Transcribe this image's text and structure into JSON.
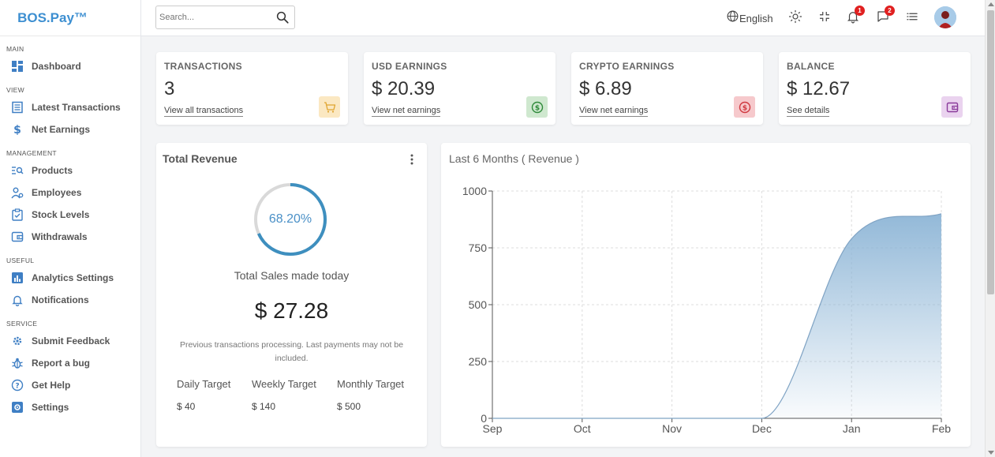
{
  "brand": {
    "name": "BOS.Pay™"
  },
  "search": {
    "placeholder": "Search..."
  },
  "topbar": {
    "language": "English",
    "notifications_count": "1",
    "messages_count": "2"
  },
  "sidebar": {
    "sections": [
      {
        "title": "MAIN",
        "items": [
          {
            "label": "Dashboard",
            "icon": "dashboard-icon"
          }
        ]
      },
      {
        "title": "VIEW",
        "items": [
          {
            "label": "Latest Transactions",
            "icon": "list-icon"
          },
          {
            "label": "Net Earnings",
            "icon": "dollar-icon"
          }
        ]
      },
      {
        "title": "MANAGEMENT",
        "items": [
          {
            "label": "Products",
            "icon": "products-search-icon"
          },
          {
            "label": "Employees",
            "icon": "employees-icon"
          },
          {
            "label": "Stock Levels",
            "icon": "clipboard-icon"
          },
          {
            "label": "Withdrawals",
            "icon": "wallet-icon"
          }
        ]
      },
      {
        "title": "USEFUL",
        "items": [
          {
            "label": "Analytics Settings",
            "icon": "analytics-icon"
          },
          {
            "label": "Notifications",
            "icon": "bell-icon"
          }
        ]
      },
      {
        "title": "SERVICE",
        "items": [
          {
            "label": "Submit Feedback",
            "icon": "feedback-icon"
          },
          {
            "label": "Report a bug",
            "icon": "bug-icon"
          },
          {
            "label": "Get Help",
            "icon": "help-icon"
          },
          {
            "label": "Settings",
            "icon": "settings-icon"
          }
        ]
      }
    ]
  },
  "stats": [
    {
      "title": "TRANSACTIONS",
      "value": "3",
      "link": "View all transactions",
      "icon": "cart-icon",
      "icon_bg": "#fbe8c2",
      "icon_color": "#e0a530"
    },
    {
      "title": "USD EARNINGS",
      "value": "$ 20.39",
      "link": "View net earnings",
      "icon": "dollar-circle-icon",
      "icon_bg": "#cfe8cf",
      "icon_color": "#2f8a3a"
    },
    {
      "title": "CRYPTO EARNINGS",
      "value": "$ 6.89",
      "link": "View net earnings",
      "icon": "dollar-circle-icon",
      "icon_bg": "#f6c9cc",
      "icon_color": "#d0383f"
    },
    {
      "title": "BALANCE",
      "value": "$ 12.67",
      "link": "See details",
      "icon": "wallet-icon",
      "icon_bg": "#ead3ef",
      "icon_color": "#8a3b9a"
    }
  ],
  "revenue": {
    "title": "Total Revenue",
    "percent_label": "68.20%",
    "percent_value": 68.2,
    "subtitle": "Total Sales made today",
    "amount": "$ 27.28",
    "note": "Previous transactions processing. Last payments may not be included.",
    "targets": [
      {
        "label": "Daily Target",
        "value": "$ 40"
      },
      {
        "label": "Weekly Target",
        "value": "$ 140"
      },
      {
        "label": "Monthly Target",
        "value": "$ 500"
      }
    ]
  },
  "chart_data": {
    "type": "area",
    "title": "Last 6 Months ( Revenue )",
    "categories": [
      "Sep",
      "Oct",
      "Nov",
      "Dec",
      "Jan",
      "Feb"
    ],
    "series": [
      {
        "values": [
          0,
          0,
          0,
          0,
          790,
          900
        ]
      }
    ],
    "yticks": [
      "0",
      "250",
      "500",
      "750",
      "1000"
    ],
    "ylim": [
      0,
      1000
    ],
    "grid": true,
    "fill_color": "#8db5d6"
  }
}
